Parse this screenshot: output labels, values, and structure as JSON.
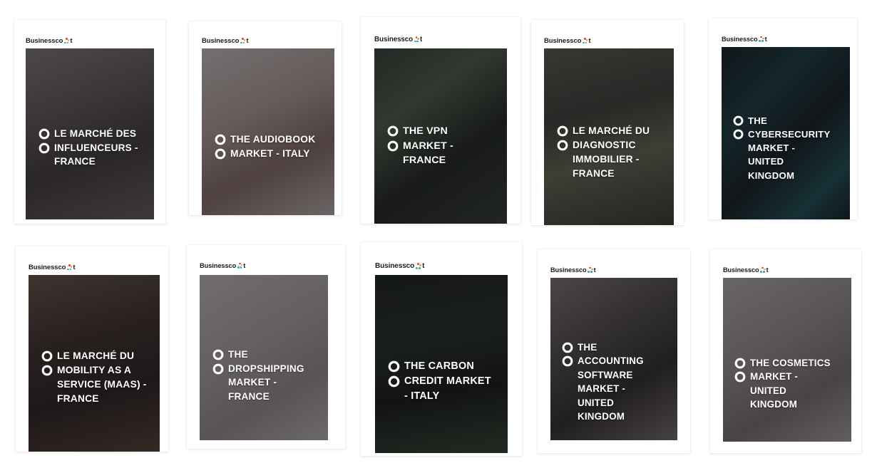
{
  "page": {
    "background": "#ffffff",
    "brand_name": "Businesscoot",
    "brand_text_color": "#1b1b1b",
    "overlay_color": "rgba(25,22,28,0.55)",
    "title_color": "#ffffff",
    "logo_ring_colors": [
      "#e8453c",
      "#f5a623",
      "#3b8ee0",
      "#2eb872",
      "#f2f2f2"
    ],
    "layout": {
      "columns": 5,
      "rows": 2,
      "total_cards": 10
    }
  },
  "cards": [
    {
      "brand": "Businesscoot",
      "title": "LE MARCHÉ DES INFLUENCEURS - FRANCE",
      "lines": [
        "LE MARCHÉ DES",
        "INFLUENCEURS -",
        "FRANCE"
      ],
      "image_subject": "people-at-cafe-phone-photo",
      "image_tone": "#6e6a66"
    },
    {
      "brand": "Businesscoot",
      "title": "THE AUDIOBOOK MARKET - ITALY",
      "lines": [
        "THE AUDIOBOOK",
        "MARKET - ITALY"
      ],
      "image_subject": "white-gold-headphones-on-bed",
      "image_tone": "#b8a9a4"
    },
    {
      "brand": "Businesscoot",
      "title": "THE VPN MARKET - FRANCE",
      "lines": [
        "THE VPN",
        "MARKET -",
        "FRANCE"
      ],
      "image_subject": "smartphone-vpn-shield-green-plant",
      "image_tone": "#3c4a3a"
    },
    {
      "brand": "Businesscoot",
      "title": "LE MARCHÉ DU DIAGNOSTIC IMMOBILIER - FRANCE",
      "lines": [
        "LE MARCHÉ DU",
        "DIAGNOSTIC",
        "IMMOBILIER -",
        "FRANCE"
      ],
      "image_subject": "aerial-view-suburban-houses-roofs",
      "image_tone": "#4a4d3f"
    },
    {
      "brand": "Businesscoot",
      "title": "THE CYBERSECURITY MARKET - UNITED KINGDOM",
      "lines": [
        "THE",
        "CYBERSECURITY",
        "MARKET -",
        "UNITED",
        "KINGDOM"
      ],
      "image_subject": "circuit-board-macro-teal",
      "image_tone": "#0e2a2c"
    },
    {
      "brand": "Businesscoot",
      "title": "LE MARCHÉ DU MOBILITY AS A SERVICE (MAAS) - FRANCE",
      "lines": [
        "LE MARCHÉ DU",
        "MOBILITY AS A",
        "SERVICE (MAAS) -",
        "FRANCE"
      ],
      "image_subject": "hand-holding-phone-map-autumn-road",
      "image_tone": "#4a3a2e"
    },
    {
      "brand": "Businesscoot",
      "title": "THE DROPSHIPPING MARKET - FRANCE",
      "lines": [
        "THE",
        "DROPSHIPPING",
        "MARKET -",
        "FRANCE"
      ],
      "image_subject": "keyboard-pencil-desk-flatlay",
      "image_tone": "#b3aeaa"
    },
    {
      "brand": "Businesscoot",
      "title": "THE CARBON CREDIT MARKET - ITALY",
      "lines": [
        "THE CARBON",
        "CREDIT MARKET",
        "- ITALY"
      ],
      "image_subject": "dark-forest-trees-green-undergrowth",
      "image_tone": "#15201a"
    },
    {
      "brand": "Businesscoot",
      "title": "THE ACCOUNTING SOFTWARE MARKET - UNITED KINGDOM",
      "lines": [
        "THE",
        "ACCOUNTING",
        "SOFTWARE",
        "MARKET -",
        "UNITED",
        "KINGDOM"
      ],
      "image_subject": "person-typing-laptop-spreadsheet",
      "image_tone": "#6d6a68"
    },
    {
      "brand": "Businesscoot",
      "title": "THE COSMETICS MARKET - UNITED KINGDOM",
      "lines": [
        "THE COSMETICS",
        "MARKET -",
        "UNITED",
        "KINGDOM"
      ],
      "image_subject": "cosmetics-powder-compacts-marble-flatlay",
      "image_tone": "#9e9a94"
    }
  ]
}
